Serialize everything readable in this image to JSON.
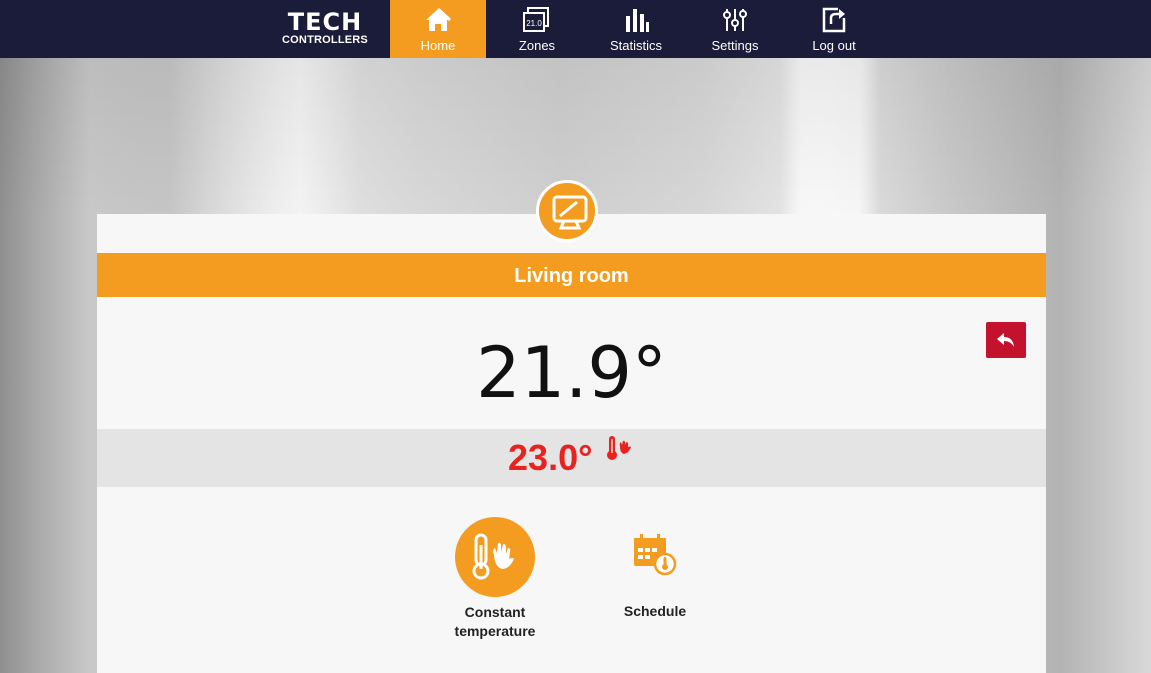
{
  "brand": {
    "logo_main": "TECH",
    "logo_sub": "CONTROLLERS"
  },
  "nav": {
    "items": [
      {
        "label": "Home",
        "icon": "home-icon",
        "active": true
      },
      {
        "label": "Zones",
        "icon": "zones-icon",
        "active": false
      },
      {
        "label": "Statistics",
        "icon": "statistics-icon",
        "active": false
      },
      {
        "label": "Settings",
        "icon": "settings-icon",
        "active": false
      },
      {
        "label": "Log out",
        "icon": "logout-icon",
        "active": false
      }
    ],
    "zones_icon_text": "21.0"
  },
  "zone": {
    "name": "Living room",
    "icon": "monitor-icon",
    "current_temperature": "21.9°",
    "set_temperature": "23.0°",
    "set_temperature_icon": "thermometer-hand-icon"
  },
  "modes": [
    {
      "label_line1": "Constant",
      "label_line2": "temperature",
      "icon": "thermometer-hand-icon",
      "active": true
    },
    {
      "label_line1": "Schedule",
      "icon": "calendar-icon",
      "active": false
    }
  ],
  "colors": {
    "accent": "#f39c1f",
    "topbar": "#1b1b3a",
    "back_button": "#c4122e",
    "setpoint_text": "#e8221f"
  }
}
